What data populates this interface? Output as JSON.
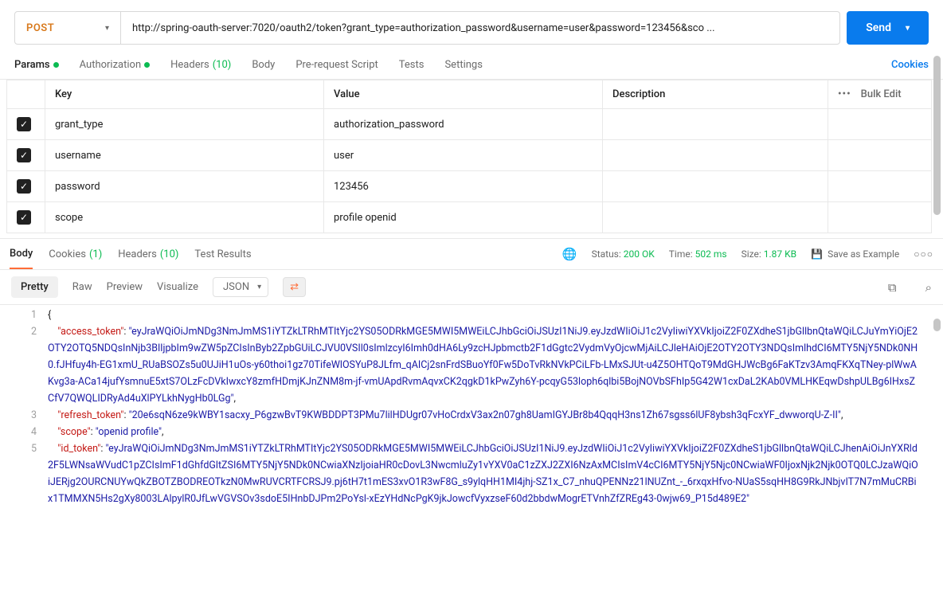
{
  "request": {
    "method": "POST",
    "url": "http://spring-oauth-server:7020/oauth2/token?grant_type=authorization_password&username=user&password=123456&sco ...",
    "send": "Send"
  },
  "reqTabs": {
    "params": "Params",
    "authorization": "Authorization",
    "headers": "Headers",
    "headersCount": "(10)",
    "body": "Body",
    "prerequest": "Pre-request Script",
    "tests": "Tests",
    "settings": "Settings",
    "cookies": "Cookies"
  },
  "paramsHeader": {
    "key": "Key",
    "value": "Value",
    "description": "Description",
    "bulkEdit": "Bulk Edit"
  },
  "params": [
    {
      "key": "grant_type",
      "value": "authorization_password"
    },
    {
      "key": "username",
      "value": "user"
    },
    {
      "key": "password",
      "value": "123456"
    },
    {
      "key": "scope",
      "value": "profile openid"
    }
  ],
  "respTabs": {
    "body": "Body",
    "cookies": "Cookies",
    "cookiesCount": "(1)",
    "headers": "Headers",
    "headersCount": "(10)",
    "testResults": "Test Results"
  },
  "status": {
    "statusLabel": "Status:",
    "statusValue": "200 OK",
    "timeLabel": "Time:",
    "timeValue": "502 ms",
    "sizeLabel": "Size:",
    "sizeValue": "1.87 KB",
    "save": "Save as Example"
  },
  "bodyToolbar": {
    "pretty": "Pretty",
    "raw": "Raw",
    "preview": "Preview",
    "visualize": "Visualize",
    "format": "JSON"
  },
  "responseBody": {
    "access_token": "eyJraWQiOiJmNDg3NmJmMS1iYTZkLTRhMTItYjc2YS05ODRkMGE5MWI5MWEiLCJhbGciOiJSUzI1NiJ9.eyJzdWIiOiJ1c2VyIiwiYXVkIjoiZ2F0ZXdheS1jbGllbnQtaWQiLCJuYmYiOjE2OTY2OTQ5NDQsInNjb3BlIjpbIm9wZW5pZCIsInByb2ZpbGUiLCJVU0VSIl0sImlzcyI6Imh0dHA6Ly9zcHJpbmctb2F1dGgtc2VydmVyOjcwMjAiLCJleHAiOjE2OTY2OTY3NDQsImlhdCI6MTY5NjY5NDk0NH0.fJHfuy4h-EG1xmU_RUaBSOZs5u0UJiH1uOs-y60thoi1gz70TifeWlOSYuP8JLfm_qAICj2snFrdSBuoYf0Fw5DoTvRkNVkPCiLFb-LMxSJUt-u4Z5OHTQoT9MdGHJWcBg6FaKTzv3AmqFKXqTNey-plWwAKvg3a-ACa14jufYsmnuE5xtS7OLzFcDVkIwxcY8zmfHDmjKJnZNM8m-jf-vmUApdRvmAqvxCK2qgkD1kPwZyh6Y-pcqyG53loph6qlbi5BojNOVbSFhIp5G42W1cxDaL2KAb0VMLHKEqwDshpULBg6IHxsZCfV7QWQLIDRyAd4uXlPYLkhNygHb0LGg",
    "refresh_token": "20e6sqN6ze9kWBY1sacxy_P6gzwBvT9KWBDDPT3PMu7lilHDUgr07vHoCrdxV3ax2n07gh8UamIGYJBr8b4QqqH3ns1Zh67sgss6lUF8ybsh3qFcxYF_dwworqU-Z-II",
    "scope": "openid profile",
    "id_token": "eyJraWQiOiJmNDg3NmJmMS1iYTZkLTRhMTItYjc2YS05ODRkMGE5MWI5MWEiLCJhbGciOiJSUzI1NiJ9.eyJzdWIiOiJ1c2VyIiwiYXVkIjoiZ2F0ZXdheS1jbGllbnQtaWQiLCJhenAiOiJnYXRld2F5LWNsaWVudC1pZCIsImF1dGhfdGltZSI6MTY5NjY5NDk0NCwiaXNzIjoiaHR0cDovL3NwcmluZy1vYXV0aC1zZXJ2ZXI6NzAxMCIsImV4cCI6MTY5NjY5Njc0NCwiaWF0IjoxNjk2Njk0OTQ0LCJzaWQiOiJERjg2OURCNUYwQkZBOTZBODREOTkzN0MwRUVCRTFCRSJ9.pj6tH7t1mES3xvO1R3wF8G_s9ylqHH1MI4jhj-SZ1x_C7_nhuQPENNz21lNUZnt_-_6rxqxHfvo-NUaS5sqHH8G9RkJNbjvIT7N7mMuCRBix1TMMXN5Hs2gXy8003LAlpylR0JfLwVGVSOv3sdoE5IHnbDJPm2PoYsl-xEzYHdNcPgK9jkJowcfVyxzseF60d2bbdwMogrETVnhZfZREg43-0wjw69_P15d489E2"
  }
}
